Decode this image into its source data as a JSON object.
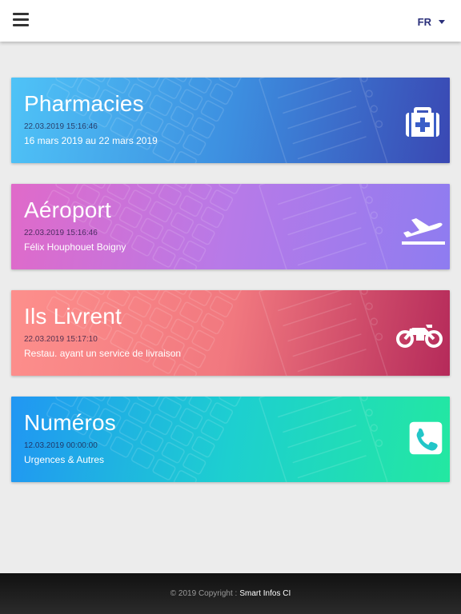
{
  "header": {
    "language": "FR"
  },
  "cards": [
    {
      "title": "Pharmacies",
      "date": "22.03.2019 15:16:46",
      "subtitle": "16 mars 2019 au 22 mars 2019",
      "icon": "medical-kit-icon"
    },
    {
      "title": "Aéroport",
      "date": "22.03.2019 15:16:46",
      "subtitle": "Félix Houphouet Boigny",
      "icon": "airplane-takeoff-icon"
    },
    {
      "title": "Ils Livrent",
      "date": "22.03.2019 15:17:10",
      "subtitle": "Restau. ayant un service de livraison",
      "icon": "motorcycle-icon"
    },
    {
      "title": "Numéros",
      "date": "12.03.2019 00:00:00",
      "subtitle": "Urgences & Autres",
      "icon": "phone-icon"
    }
  ],
  "footer": {
    "copyright": "© 2019 Copyright :",
    "brand": "Smart Infos CI"
  },
  "colors": {
    "accent": "#2a2f7a",
    "pharmacies": "#3d8fe0",
    "aeroport": "#b77ae8",
    "livrent": "#f1787f",
    "numeros": "#1dcfd0"
  }
}
